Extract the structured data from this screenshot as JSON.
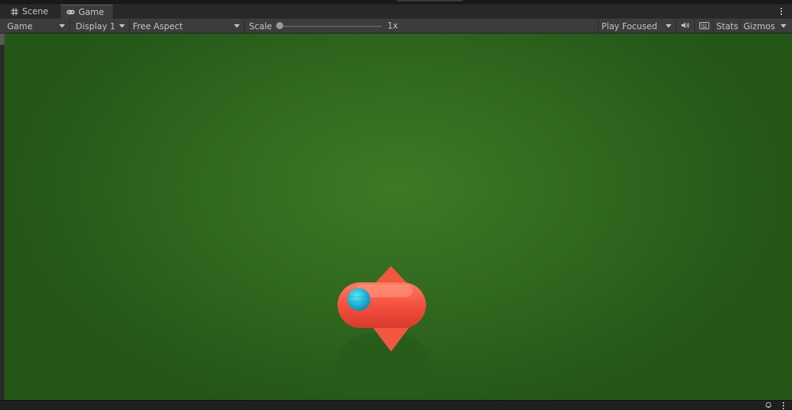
{
  "tabs": [
    {
      "label": "Scene",
      "icon": "grid-icon",
      "active": false
    },
    {
      "label": "Game",
      "icon": "gamepad-icon",
      "active": true
    }
  ],
  "toolbar": {
    "view_dropdown": "Game",
    "display_dropdown": "Display 1",
    "aspect_dropdown": "Free Aspect",
    "scale_label": "Scale",
    "scale_value": "1x",
    "scale_slider_position": 0,
    "play_mode_dropdown": "Play Focused",
    "audio_icon": "speaker-icon",
    "keyboard_icon": "keyboard-icon",
    "stats_label": "Stats",
    "gizmos_label": "Gizmos"
  },
  "colors": {
    "panel_bg": "#3c3c3c",
    "tabbar_bg": "#282828",
    "text": "#c4c4c4",
    "ground_green": "#316a20",
    "player_red": "#f04c3c",
    "player_cyan": "#28c8e0"
  },
  "status_icons": [
    "bell-icon",
    "kebab-menu-icon"
  ]
}
